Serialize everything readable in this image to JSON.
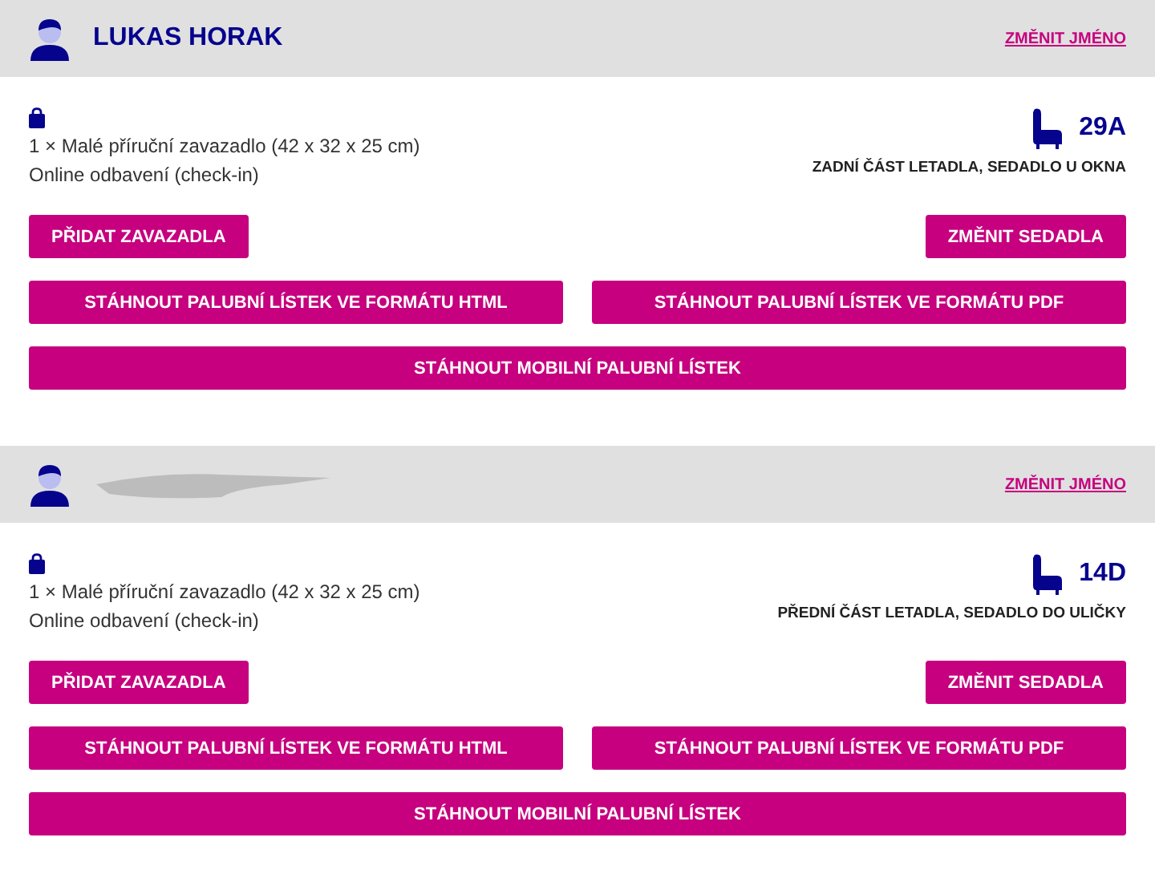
{
  "passengers": [
    {
      "name": "LUKAS HORAK",
      "redacted": false,
      "change_name": "ZMĚNIT JMÉNO",
      "baggage": "1 × Malé příruční zavazadlo (42 x 32 x 25 cm)",
      "checkin": "Online odbavení (check-in)",
      "seat": "29A",
      "seat_location": "ZADNÍ ČÁST LETADLA, SEDADLO U OKNA",
      "add_baggage": "PŘIDAT ZAVAZADLA",
      "change_seat": "ZMĚNIT SEDADLA",
      "download_html": "STÁHNOUT PALUBNÍ LÍSTEK VE FORMÁTU HTML",
      "download_pdf": "STÁHNOUT PALUBNÍ LÍSTEK VE FORMÁTU PDF",
      "download_mobile": "STÁHNOUT MOBILNÍ PALUBNÍ LÍSTEK"
    },
    {
      "redacted": true,
      "change_name": "ZMĚNIT JMÉNO",
      "baggage": "1 × Malé příruční zavazadlo (42 x 32 x 25 cm)",
      "checkin": "Online odbavení (check-in)",
      "seat": "14D",
      "seat_location": "PŘEDNÍ ČÁST LETADLA, SEDADLO DO ULIČKY",
      "add_baggage": "PŘIDAT ZAVAZADLA",
      "change_seat": "ZMĚNIT SEDADLA",
      "download_html": "STÁHNOUT PALUBNÍ LÍSTEK VE FORMÁTU HTML",
      "download_pdf": "STÁHNOUT PALUBNÍ LÍSTEK VE FORMÁTU PDF",
      "download_mobile": "STÁHNOUT MOBILNÍ PALUBNÍ LÍSTEK"
    }
  ]
}
